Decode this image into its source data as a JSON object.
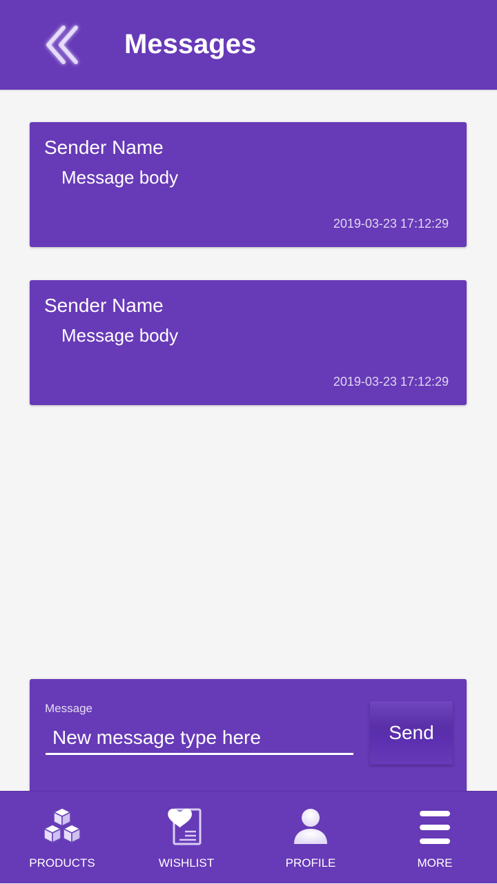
{
  "header": {
    "title": "Messages",
    "back_icon": "double-chevron-left-icon"
  },
  "messages": [
    {
      "sender": "Sender Name",
      "body": "Message body",
      "timestamp": "2019-03-23 17:12:29"
    },
    {
      "sender": "Sender Name",
      "body": "Message body",
      "timestamp": "2019-03-23 17:12:29"
    }
  ],
  "composer": {
    "label": "Message",
    "placeholder": "New message type here",
    "value": "",
    "send_label": "Send"
  },
  "bottom_nav": [
    {
      "label": "PRODUCTS",
      "icon": "boxes-icon"
    },
    {
      "label": "WISHLIST",
      "icon": "heart-list-icon"
    },
    {
      "label": "PROFILE",
      "icon": "user-icon"
    },
    {
      "label": "MORE",
      "icon": "menu-icon"
    }
  ],
  "colors": {
    "primary": "#673ab7",
    "background": "#f5f5f5",
    "text_on_primary": "#ffffff"
  }
}
